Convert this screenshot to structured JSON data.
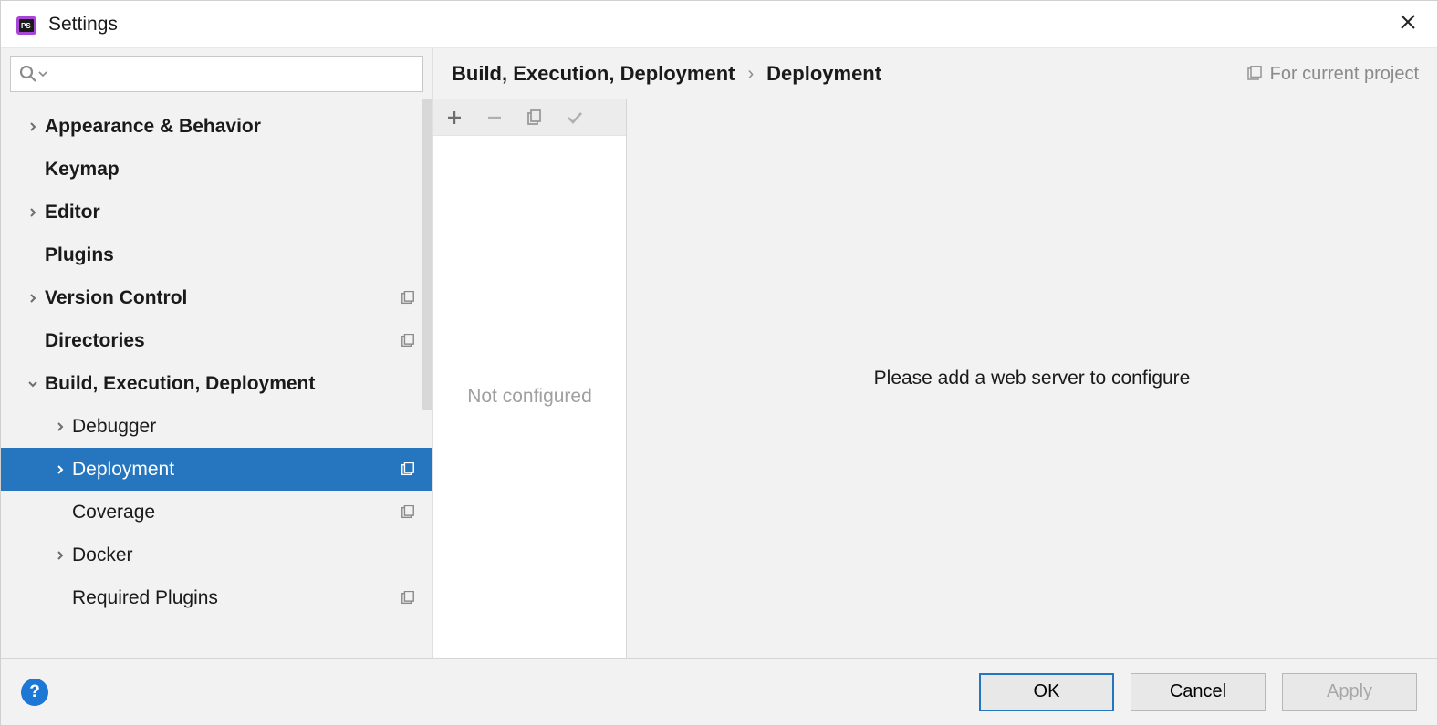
{
  "window": {
    "title": "Settings"
  },
  "search": {
    "value": "",
    "placeholder": ""
  },
  "tree": {
    "items": [
      {
        "label": "Appearance & Behavior",
        "level": 0,
        "bold": true,
        "expandable": true,
        "expanded": false,
        "proj": false,
        "selected": false
      },
      {
        "label": "Keymap",
        "level": 0,
        "bold": true,
        "expandable": false,
        "proj": false,
        "selected": false
      },
      {
        "label": "Editor",
        "level": 0,
        "bold": true,
        "expandable": true,
        "expanded": false,
        "proj": false,
        "selected": false
      },
      {
        "label": "Plugins",
        "level": 0,
        "bold": true,
        "expandable": false,
        "proj": false,
        "selected": false
      },
      {
        "label": "Version Control",
        "level": 0,
        "bold": true,
        "expandable": true,
        "expanded": false,
        "proj": true,
        "selected": false
      },
      {
        "label": "Directories",
        "level": 0,
        "bold": true,
        "expandable": false,
        "proj": true,
        "selected": false
      },
      {
        "label": "Build, Execution, Deployment",
        "level": 0,
        "bold": true,
        "expandable": true,
        "expanded": true,
        "proj": false,
        "selected": false
      },
      {
        "label": "Debugger",
        "level": 1,
        "bold": false,
        "expandable": true,
        "expanded": false,
        "proj": false,
        "selected": false
      },
      {
        "label": "Deployment",
        "level": 1,
        "bold": false,
        "expandable": true,
        "expanded": false,
        "proj": true,
        "selected": true
      },
      {
        "label": "Coverage",
        "level": 1,
        "bold": false,
        "expandable": false,
        "proj": true,
        "selected": false
      },
      {
        "label": "Docker",
        "level": 1,
        "bold": false,
        "expandable": true,
        "expanded": false,
        "proj": false,
        "selected": false
      },
      {
        "label": "Required Plugins",
        "level": 1,
        "bold": false,
        "expandable": false,
        "proj": true,
        "selected": false
      }
    ]
  },
  "breadcrumb": {
    "part1": "Build, Execution, Deployment",
    "part2": "Deployment",
    "scope": "For current project"
  },
  "server_list": {
    "empty_text": "Not configured"
  },
  "detail": {
    "empty_text": "Please add a web server to configure"
  },
  "footer": {
    "ok": "OK",
    "cancel": "Cancel",
    "apply": "Apply"
  }
}
